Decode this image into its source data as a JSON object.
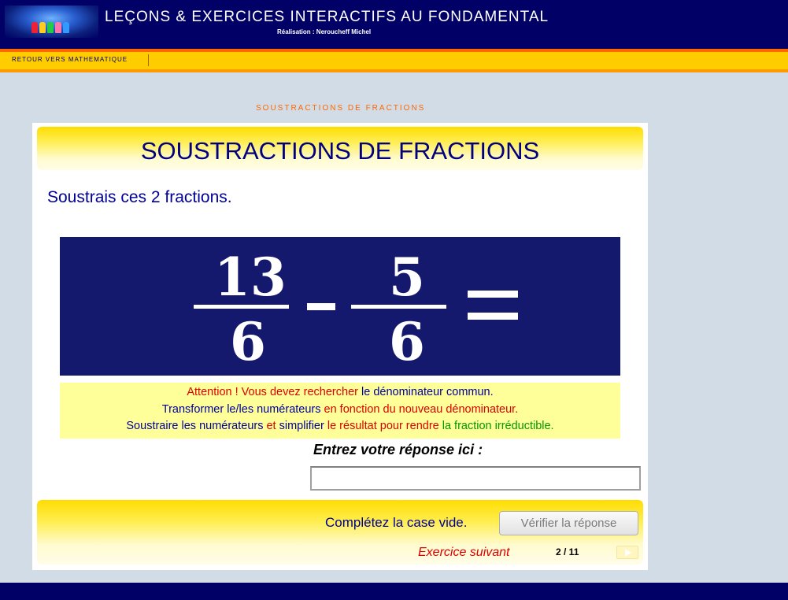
{
  "header": {
    "title": "LEÇONS & EXERCICES INTERACTIFS AU FONDAMENTAL",
    "subtitle": "Réalisation : Neroucheff Michel"
  },
  "nav": {
    "back_link": "RETOUR VERS MATHEMATIQUE"
  },
  "breadcrumb": "SOUSTRACTIONS DE FRACTIONS",
  "exercise": {
    "title": "SOUSTRACTIONS DE FRACTIONS",
    "instruction": "Soustrais ces 2 fractions.",
    "fraction1": {
      "numerator": "13",
      "denominator": "6"
    },
    "fraction2": {
      "numerator": "5",
      "denominator": "6"
    },
    "hints": {
      "line1": [
        "Attention ! Vous devez rechercher",
        " le dénominateur commun."
      ],
      "line2": [
        "Transformer le/les numérateurs",
        " en fonction du nouveau dénominateur."
      ],
      "line3": [
        "Soustraire les numérateurs",
        " et ",
        "simplifier",
        " le résultat pour rendre",
        " la fraction irréductible."
      ]
    },
    "answer_label": "Entrez votre réponse ici :",
    "answer_value": "",
    "status": "Complétez la case vide.",
    "verify_button": "Vérifier la réponse",
    "next_link": "Exercice suivant",
    "progress": "2 / 11"
  },
  "colors": {
    "header_bg": "#000066",
    "nav_bg": "#ffcc00",
    "accent_orange": "#ff6600",
    "fraction_bg": "#14196e",
    "hint_bg": "#ffff99"
  }
}
